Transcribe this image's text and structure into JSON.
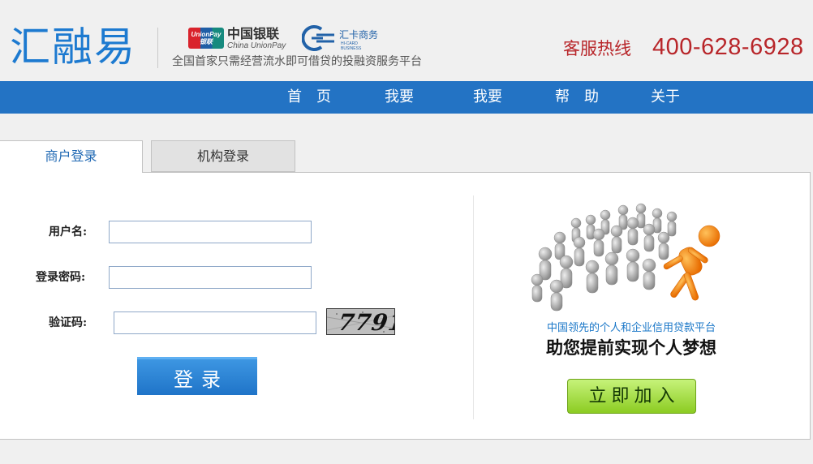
{
  "header": {
    "logo": "汇融易",
    "unionpay_badge": "UnionPay 银联",
    "unionpay_cn": "中国银联",
    "unionpay_en": "China UnionPay",
    "hicard_cn": "汇卡商务",
    "hicard_en": "HI-CARD BUSINESS",
    "slogan": "全国首家只需经营流水即可借贷的投融资服务平台",
    "hotline_label": "客服热线",
    "hotline_number": "400-628-6928"
  },
  "nav": {
    "items": [
      "首　页",
      "我要",
      "我要",
      "帮　助",
      "关于"
    ]
  },
  "tabs": {
    "merchant": "商户登录",
    "institution": "机构登录"
  },
  "login": {
    "username_label": "用户名:",
    "password_label": "登录密码:",
    "captcha_label": "验证码:",
    "username_value": "",
    "password_value": "",
    "captcha_value": "",
    "captcha_image_text": "7791",
    "submit_label": "登录"
  },
  "promo": {
    "subtitle": "中国领先的个人和企业信用贷款平台",
    "title": "助您提前实现个人梦想",
    "join_label": "立即加入"
  },
  "colors": {
    "brand_blue": "#1d7ad0",
    "nav_blue": "#2373c4",
    "hotline_red": "#b8262a",
    "join_green": "#8ccc22",
    "runner_orange": "#f07d00"
  }
}
